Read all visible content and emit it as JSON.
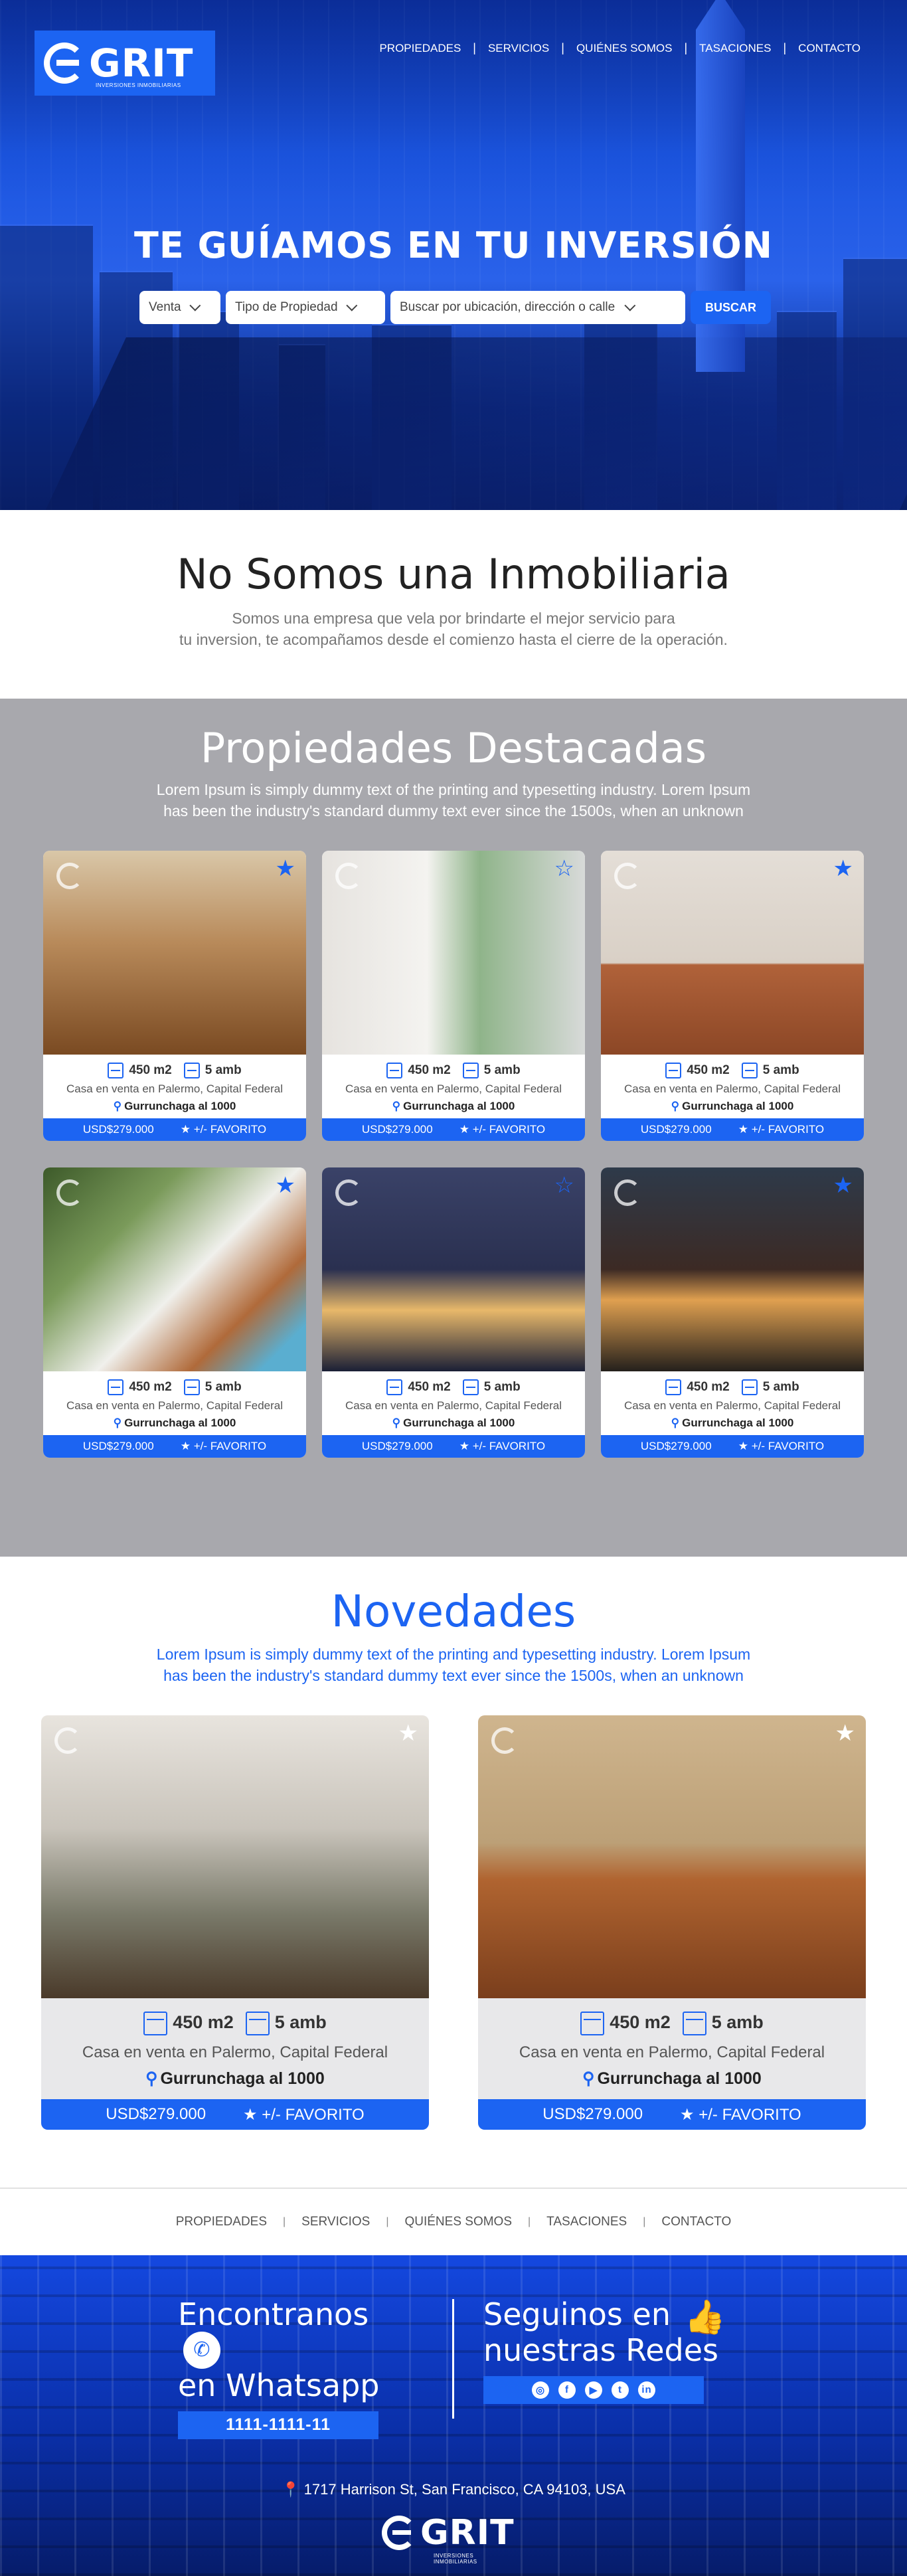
{
  "brand": {
    "name": "GRIT",
    "tagline": "INVERSIONES INMOBILIARIAS"
  },
  "nav": [
    "PROPIEDADES",
    "SERVICIOS",
    "QUIÉNES SOMOS",
    "TASACIONES",
    "CONTACTO"
  ],
  "hero": {
    "title": "TE GUÍAMOS EN TU INVERSIÓN",
    "operation": "Venta",
    "type": "Tipo de Propiedad",
    "search_placeholder": "Buscar por ubicación, dirección o calle",
    "button": "BUSCAR"
  },
  "intro": {
    "title": "No Somos una Inmobiliaria",
    "line1": "Somos una empresa que vela por brindarte el mejor servicio para",
    "line2": "tu inversion, te acompañamos desde el comienzo hasta el cierre de la operación."
  },
  "featured": {
    "title": "Propiedades Destacadas",
    "line1": "Lorem Ipsum is simply dummy text of the printing and typesetting industry. Lorem Ipsum",
    "line2": "has been the industry's standard dummy text ever since the 1500s, when an unknown"
  },
  "news": {
    "title": "Novedades",
    "line1": "Lorem Ipsum is simply dummy text of the printing and typesetting industry. Lorem Ipsum",
    "line2": "has been the industry's standard dummy text ever since the 1500s, when an unknown"
  },
  "card": {
    "area": "450 m2",
    "rooms": "5 amb",
    "desc": "Casa en venta en Palermo, Capital Federal",
    "address": "Gurrunchaga al 1000",
    "price": "USD$279.000",
    "fav": "+/- FAVORITO"
  },
  "footer": {
    "whatsapp_title_1": "Encontranos",
    "whatsapp_title_2": "en Whatsapp",
    "phone": "1111-1111-11",
    "social_title_1": "Seguinos en",
    "social_title_2": "nuestras Redes",
    "address": "1717 Harrison St, San Francisco, CA 94103, USA"
  },
  "colors": {
    "primary": "#1c64f2",
    "gray_band": "#a8a8ad"
  }
}
